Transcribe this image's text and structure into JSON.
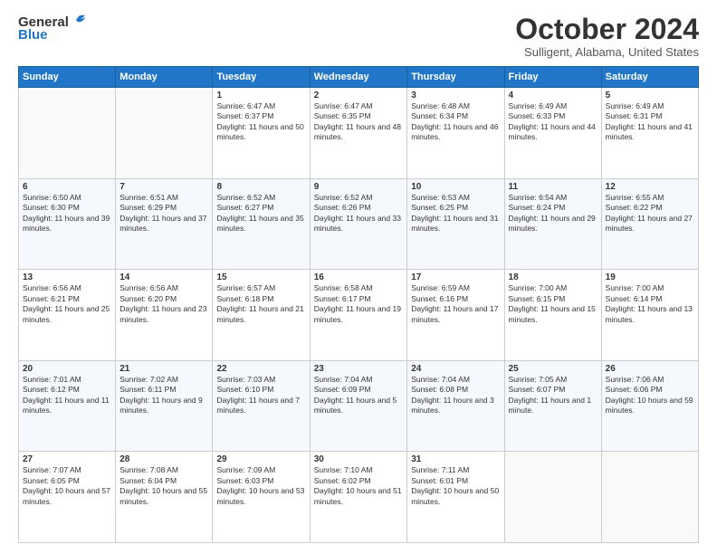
{
  "header": {
    "logo_line1": "General",
    "logo_line2": "Blue",
    "month": "October 2024",
    "location": "Sulligent, Alabama, United States"
  },
  "days_of_week": [
    "Sunday",
    "Monday",
    "Tuesday",
    "Wednesday",
    "Thursday",
    "Friday",
    "Saturday"
  ],
  "weeks": [
    [
      {
        "day": "",
        "text": ""
      },
      {
        "day": "",
        "text": ""
      },
      {
        "day": "1",
        "text": "Sunrise: 6:47 AM\nSunset: 6:37 PM\nDaylight: 11 hours and 50 minutes."
      },
      {
        "day": "2",
        "text": "Sunrise: 6:47 AM\nSunset: 6:35 PM\nDaylight: 11 hours and 48 minutes."
      },
      {
        "day": "3",
        "text": "Sunrise: 6:48 AM\nSunset: 6:34 PM\nDaylight: 11 hours and 46 minutes."
      },
      {
        "day": "4",
        "text": "Sunrise: 6:49 AM\nSunset: 6:33 PM\nDaylight: 11 hours and 44 minutes."
      },
      {
        "day": "5",
        "text": "Sunrise: 6:49 AM\nSunset: 6:31 PM\nDaylight: 11 hours and 41 minutes."
      }
    ],
    [
      {
        "day": "6",
        "text": "Sunrise: 6:50 AM\nSunset: 6:30 PM\nDaylight: 11 hours and 39 minutes."
      },
      {
        "day": "7",
        "text": "Sunrise: 6:51 AM\nSunset: 6:29 PM\nDaylight: 11 hours and 37 minutes."
      },
      {
        "day": "8",
        "text": "Sunrise: 6:52 AM\nSunset: 6:27 PM\nDaylight: 11 hours and 35 minutes."
      },
      {
        "day": "9",
        "text": "Sunrise: 6:52 AM\nSunset: 6:26 PM\nDaylight: 11 hours and 33 minutes."
      },
      {
        "day": "10",
        "text": "Sunrise: 6:53 AM\nSunset: 6:25 PM\nDaylight: 11 hours and 31 minutes."
      },
      {
        "day": "11",
        "text": "Sunrise: 6:54 AM\nSunset: 6:24 PM\nDaylight: 11 hours and 29 minutes."
      },
      {
        "day": "12",
        "text": "Sunrise: 6:55 AM\nSunset: 6:22 PM\nDaylight: 11 hours and 27 minutes."
      }
    ],
    [
      {
        "day": "13",
        "text": "Sunrise: 6:56 AM\nSunset: 6:21 PM\nDaylight: 11 hours and 25 minutes."
      },
      {
        "day": "14",
        "text": "Sunrise: 6:56 AM\nSunset: 6:20 PM\nDaylight: 11 hours and 23 minutes."
      },
      {
        "day": "15",
        "text": "Sunrise: 6:57 AM\nSunset: 6:18 PM\nDaylight: 11 hours and 21 minutes."
      },
      {
        "day": "16",
        "text": "Sunrise: 6:58 AM\nSunset: 6:17 PM\nDaylight: 11 hours and 19 minutes."
      },
      {
        "day": "17",
        "text": "Sunrise: 6:59 AM\nSunset: 6:16 PM\nDaylight: 11 hours and 17 minutes."
      },
      {
        "day": "18",
        "text": "Sunrise: 7:00 AM\nSunset: 6:15 PM\nDaylight: 11 hours and 15 minutes."
      },
      {
        "day": "19",
        "text": "Sunrise: 7:00 AM\nSunset: 6:14 PM\nDaylight: 11 hours and 13 minutes."
      }
    ],
    [
      {
        "day": "20",
        "text": "Sunrise: 7:01 AM\nSunset: 6:12 PM\nDaylight: 11 hours and 11 minutes."
      },
      {
        "day": "21",
        "text": "Sunrise: 7:02 AM\nSunset: 6:11 PM\nDaylight: 11 hours and 9 minutes."
      },
      {
        "day": "22",
        "text": "Sunrise: 7:03 AM\nSunset: 6:10 PM\nDaylight: 11 hours and 7 minutes."
      },
      {
        "day": "23",
        "text": "Sunrise: 7:04 AM\nSunset: 6:09 PM\nDaylight: 11 hours and 5 minutes."
      },
      {
        "day": "24",
        "text": "Sunrise: 7:04 AM\nSunset: 6:08 PM\nDaylight: 11 hours and 3 minutes."
      },
      {
        "day": "25",
        "text": "Sunrise: 7:05 AM\nSunset: 6:07 PM\nDaylight: 11 hours and 1 minute."
      },
      {
        "day": "26",
        "text": "Sunrise: 7:06 AM\nSunset: 6:06 PM\nDaylight: 10 hours and 59 minutes."
      }
    ],
    [
      {
        "day": "27",
        "text": "Sunrise: 7:07 AM\nSunset: 6:05 PM\nDaylight: 10 hours and 57 minutes."
      },
      {
        "day": "28",
        "text": "Sunrise: 7:08 AM\nSunset: 6:04 PM\nDaylight: 10 hours and 55 minutes."
      },
      {
        "day": "29",
        "text": "Sunrise: 7:09 AM\nSunset: 6:03 PM\nDaylight: 10 hours and 53 minutes."
      },
      {
        "day": "30",
        "text": "Sunrise: 7:10 AM\nSunset: 6:02 PM\nDaylight: 10 hours and 51 minutes."
      },
      {
        "day": "31",
        "text": "Sunrise: 7:11 AM\nSunset: 6:01 PM\nDaylight: 10 hours and 50 minutes."
      },
      {
        "day": "",
        "text": ""
      },
      {
        "day": "",
        "text": ""
      }
    ]
  ]
}
